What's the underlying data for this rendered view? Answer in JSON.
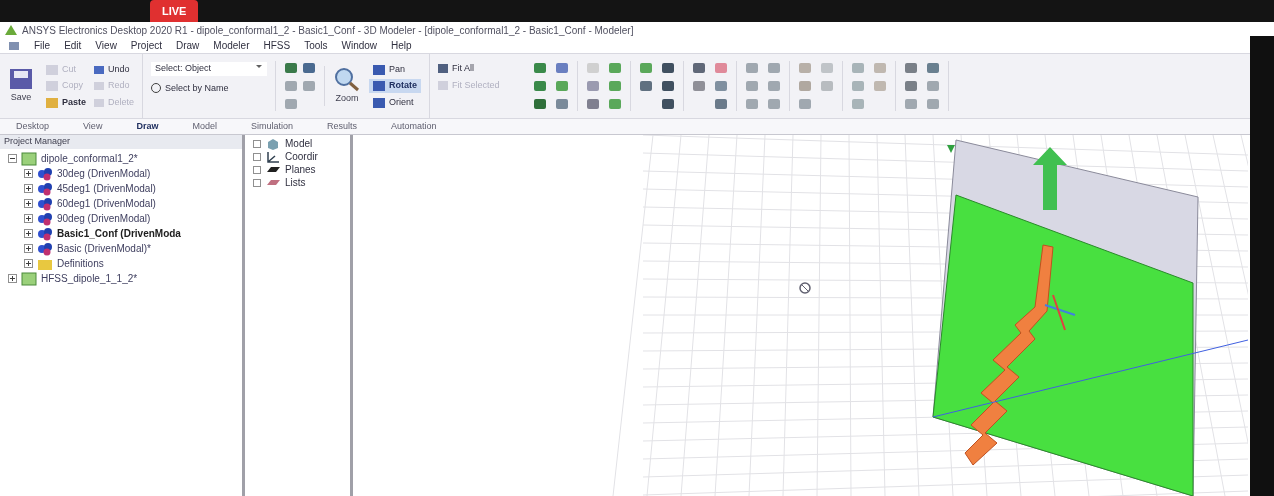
{
  "stream_bar": {
    "badge": "LIVE"
  },
  "window": {
    "title": "ANSYS Electronics Desktop 2020 R1 - dipole_conformal1_2 - Basic1_Conf - 3D Modeler - [dipole_conformal1_2 - Basic1_Conf - Modeler]"
  },
  "menu": [
    "File",
    "Edit",
    "View",
    "Project",
    "Draw",
    "Modeler",
    "HFSS",
    "Tools",
    "Window",
    "Help"
  ],
  "ribbon": {
    "save": "Save",
    "clipboard": [
      {
        "label": "Cut",
        "disabled": true
      },
      {
        "label": "Copy",
        "disabled": true
      },
      {
        "label": "Paste",
        "disabled": false
      }
    ],
    "history": [
      {
        "label": "Undo",
        "disabled": false
      },
      {
        "label": "Redo",
        "disabled": true
      },
      {
        "label": "Delete",
        "disabled": true
      }
    ],
    "select": {
      "value": "Select: Object",
      "by_name": "Select by Name"
    },
    "zoom": "Zoom",
    "view_tools": [
      {
        "label": "Pan",
        "selected": false
      },
      {
        "label": "Rotate",
        "selected": true
      },
      {
        "label": "Orient",
        "selected": false
      }
    ],
    "fit": [
      {
        "label": "Fit All",
        "disabled": false
      },
      {
        "label": "Fit Selected",
        "disabled": true
      }
    ]
  },
  "tabs": [
    {
      "label": "Desktop",
      "selected": false
    },
    {
      "label": "View",
      "selected": false
    },
    {
      "label": "Draw",
      "selected": true
    },
    {
      "label": "Model",
      "selected": false
    },
    {
      "label": "Simulation",
      "selected": false
    },
    {
      "label": "Results",
      "selected": false
    },
    {
      "label": "Automation",
      "selected": false
    }
  ],
  "project_manager": {
    "title": "Project Manager",
    "tree": [
      {
        "label": "dipole_conformal1_2*",
        "kind": "project",
        "expanded": true,
        "children": [
          {
            "label": "30deg (DrivenModal)",
            "kind": "design",
            "selected": false
          },
          {
            "label": "45deg1 (DrivenModal)",
            "kind": "design",
            "selected": false
          },
          {
            "label": "60deg1 (DrivenModal)",
            "kind": "design",
            "selected": false
          },
          {
            "label": "90deg (DrivenModal)",
            "kind": "design",
            "selected": false
          },
          {
            "label": "Basic1_Conf (DrivenModa",
            "kind": "design",
            "selected": true
          },
          {
            "label": "Basic (DrivenModal)*",
            "kind": "design",
            "selected": false
          },
          {
            "label": "Definitions",
            "kind": "folder",
            "selected": false
          }
        ]
      },
      {
        "label": "HFSS_dipole_1_1_2*",
        "kind": "project",
        "expanded": false
      }
    ]
  },
  "model_tree": [
    {
      "label": "Model",
      "kind": "model"
    },
    {
      "label": "Coordir",
      "kind": "coords"
    },
    {
      "label": "Planes",
      "kind": "planes"
    },
    {
      "label": "Lists",
      "kind": "lists"
    }
  ]
}
